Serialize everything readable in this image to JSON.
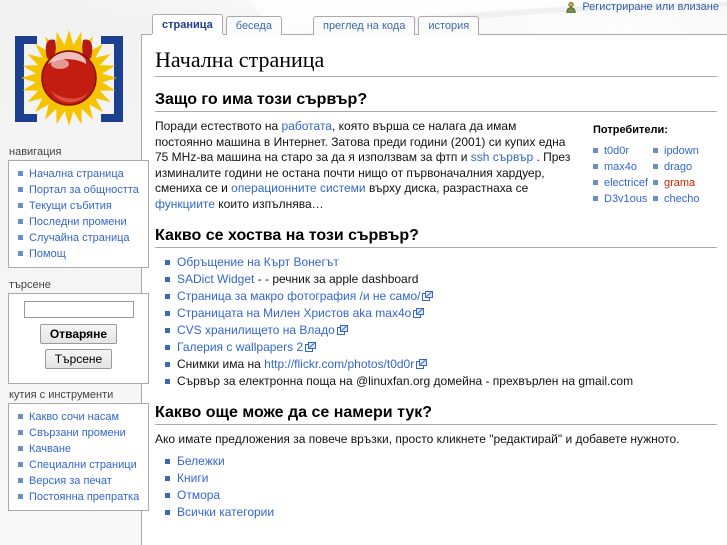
{
  "personal": {
    "icon": "user-icon",
    "login_label": "Регистриране или влизане"
  },
  "tabs": [
    {
      "label": "страница",
      "selected": true
    },
    {
      "label": "беседа",
      "selected": false
    },
    {
      "label": "преглед на кода",
      "selected": false
    },
    {
      "label": "история",
      "selected": false
    }
  ],
  "sidebar": {
    "logo_alt": "red-devil-sun-logo",
    "navigation": {
      "heading": "навигация",
      "items": [
        "Начална страница",
        "Портал за общността",
        "Текущи събития",
        "Последни промени",
        "Случайна страница",
        "Помощ"
      ]
    },
    "search": {
      "heading": "търсене",
      "input_value": "",
      "go_label": "Отваряне",
      "search_label": "Търсене"
    },
    "toolbox": {
      "heading": "кутия с инструменти",
      "items": [
        "Какво сочи насам",
        "Свързани промени",
        "Качване",
        "Специални страници",
        "Версия за печат",
        "Постоянна препратка"
      ]
    }
  },
  "content": {
    "title": "Начална страница",
    "section1": {
      "heading": "Защо го има този сървър?",
      "p1_a": "Поради естеството на ",
      "p1_link1": "работата",
      "p1_b": ", която върша се налага да имам постоянно машина в Интернет. Затова преди години (2001) си купих една 75 MHz-ва машина на старо за да я използвам за фтп и ",
      "p1_link2": "ssh сървър",
      "p1_c": " . През изминалите години не остана почти нищо от първоначалния хардуер, смениха се и ",
      "p1_link3": "операционните системи",
      "p1_d": " върху диска, разрастнаха се ",
      "p1_link4": "функциите",
      "p1_e": " които изпълнява…"
    },
    "users": {
      "heading": "Потребители:",
      "col1": [
        {
          "name": "t0d0r",
          "red": false
        },
        {
          "name": "max4o",
          "red": false
        },
        {
          "name": "electricef",
          "red": false
        },
        {
          "name": "D3v1ous",
          "red": false
        }
      ],
      "col2": [
        {
          "name": "ipdown",
          "red": false
        },
        {
          "name": "drago",
          "red": false
        },
        {
          "name": "grama",
          "red": true
        },
        {
          "name": "checho",
          "red": false
        }
      ]
    },
    "section2": {
      "heading": "Какво се хоства на този сървър?",
      "items": [
        {
          "link": "Обръщение на Кърт Вонегът",
          "after": "",
          "ext": false
        },
        {
          "link": "SADict Widget",
          "after": " - - речник за apple dashboard",
          "ext": false
        },
        {
          "link": "Страница за макро фотография /и не само/",
          "after": "",
          "ext": true
        },
        {
          "link": "Страницата на Милен Христов aka max4o",
          "after": "",
          "ext": true
        },
        {
          "link": "CVS хранилището на Владо",
          "after": "",
          "ext": true
        },
        {
          "link": "Галерия с wallpapers 2",
          "after": "",
          "ext": true
        },
        {
          "before": "Снимки има на ",
          "link": "http://flickr.com/photos/t0d0r",
          "after": "",
          "ext": true
        },
        {
          "plain": "Сървър за електронна поща на @linuxfan.org домейна - прехвърлен на gmail.com"
        }
      ]
    },
    "section3": {
      "heading": "Какво още може да се намери тук?",
      "intro": "Ако имате предложения за повече връзки, просто кликнете \"редактирай\" и добавете нужното.",
      "items": [
        "Бележки",
        "Книги",
        "Отмора",
        "Всички категории"
      ]
    }
  },
  "colors": {
    "link": "#3366cc",
    "red_link": "#cc2200",
    "bullet": "#6a8fc4",
    "border": "#aaaaaa",
    "tab_text": "#3b6ab3"
  }
}
